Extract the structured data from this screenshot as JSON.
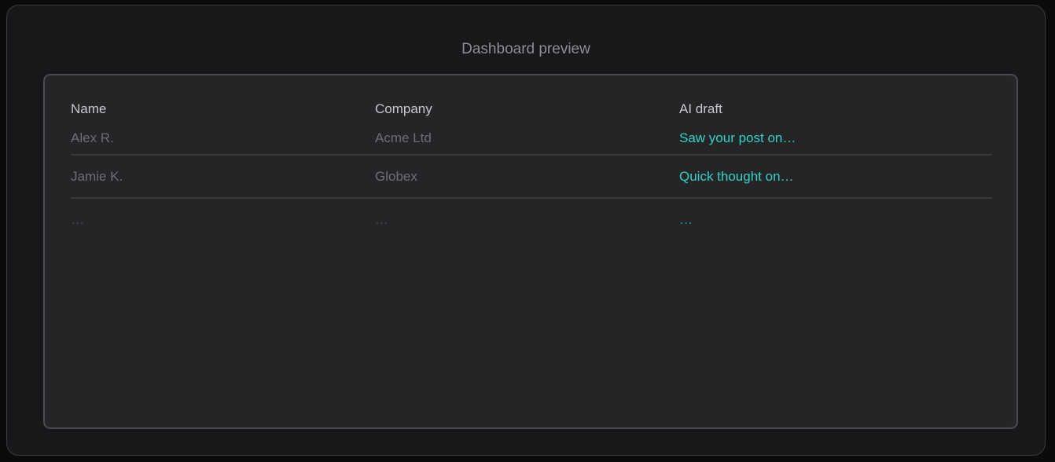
{
  "title": "Dashboard preview",
  "table": {
    "columns": [
      "Name",
      "Company",
      "AI draft"
    ],
    "rows": [
      {
        "name": "Alex R.",
        "company": "Acme Ltd",
        "draft": "Saw your post on…"
      },
      {
        "name": "Jamie K.",
        "company": "Globex",
        "draft": "Quick thought on…"
      },
      {
        "name": "…",
        "company": "…",
        "draft": "…"
      }
    ]
  },
  "colors": {
    "accent": "#2fd4c3",
    "panel_bg": "#252527",
    "outer_bg": "#18181a"
  }
}
